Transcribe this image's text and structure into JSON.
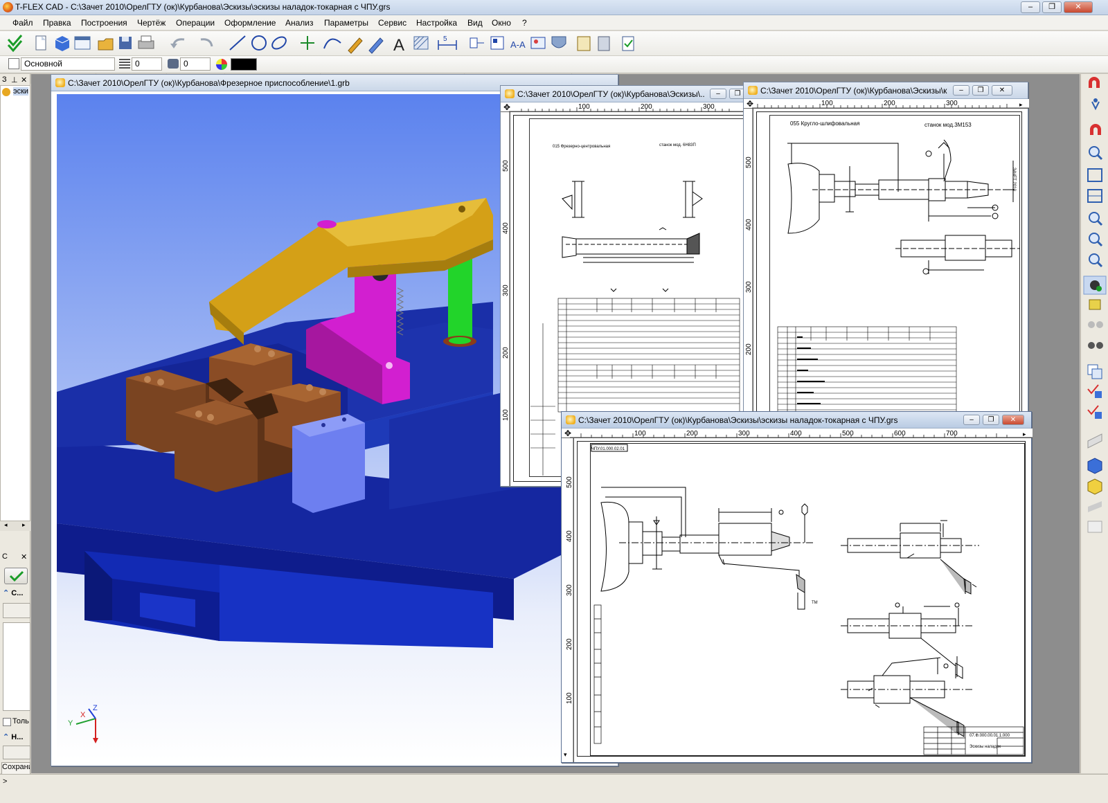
{
  "app": {
    "title": "T-FLEX CAD - С:\\Зачет 2010\\ОрелГТУ (ок)\\Курбанова\\Эскизы\\эскизы наладок-токарная с ЧПУ.grs"
  },
  "window_controls": {
    "minimize": "–",
    "maximize": "❐",
    "close": "✕"
  },
  "menu": [
    "Файл",
    "Правка",
    "Построения",
    "Чертёж",
    "Операции",
    "Оформление",
    "Анализ",
    "Параметры",
    "Сервис",
    "Настройка",
    "Вид",
    "Окно",
    "?"
  ],
  "toolbar2": {
    "layer_combo": "Основной",
    "level_value": "0",
    "priority_value": "0",
    "color": "#000000"
  },
  "leftpanel": {
    "top_header": "З",
    "top_pin": "⊥",
    "top_close": "✕",
    "tree_item": "эски",
    "bottom_header": "С",
    "section1": "С...",
    "checkbox_label": "Толь",
    "section2": "Н...",
    "save_button": "Сохрани"
  },
  "windows": {
    "model3d": {
      "title": "С:\\Зачет 2010\\ОрелГТУ (ок)\\Курбанова\\Фрезерное приспособление\\1.grb"
    },
    "sketch1": {
      "title": "С:\\Зачет 2010\\ОрелГТУ (ок)\\Курбанова\\Эскизы\\..."
    },
    "sketch2": {
      "title": "С:\\Зачет 2010\\ОрелГТУ (ок)\\Курбанова\\Эскизы\\кр..."
    },
    "sketch3": {
      "title": "С:\\Зачет 2010\\ОрелГТУ (ок)\\Курбанова\\Эскизы\\эскизы наладок-токарная с ЧПУ.grs"
    }
  },
  "rulers": {
    "sketch1_h": [
      "100",
      "200",
      "300"
    ],
    "sketch1_v": [
      "500",
      "400",
      "300",
      "200",
      "100"
    ],
    "sketch2_h": [
      "100",
      "200",
      "300"
    ],
    "sketch2_v": [
      "500",
      "400",
      "300",
      "200"
    ],
    "sketch3_h": [
      "100",
      "200",
      "300",
      "400",
      "500",
      "600",
      "700"
    ],
    "sketch3_v": [
      "500",
      "400",
      "300",
      "200",
      "100"
    ]
  },
  "sketch1": {
    "op_text": "015 Фрезерно-центровальная",
    "machine_text": "станок мод. 6Н83П"
  },
  "sketch2": {
    "op_text": "055 Кругло-шлифовальная",
    "machine_text": "станок мод.3М153"
  },
  "axes": {
    "x": "X",
    "y": "Y",
    "z": "Z"
  },
  "status": {
    "prompt": ">"
  },
  "colors": {
    "model_bg_top": "#5b82ee",
    "model_bg_bottom": "#ffffff",
    "base_blue": "#1a2fa8",
    "clamp": "#d4a017",
    "post": "#d21fd0",
    "pin": "#22d42a",
    "jaw": "#7a4421"
  }
}
